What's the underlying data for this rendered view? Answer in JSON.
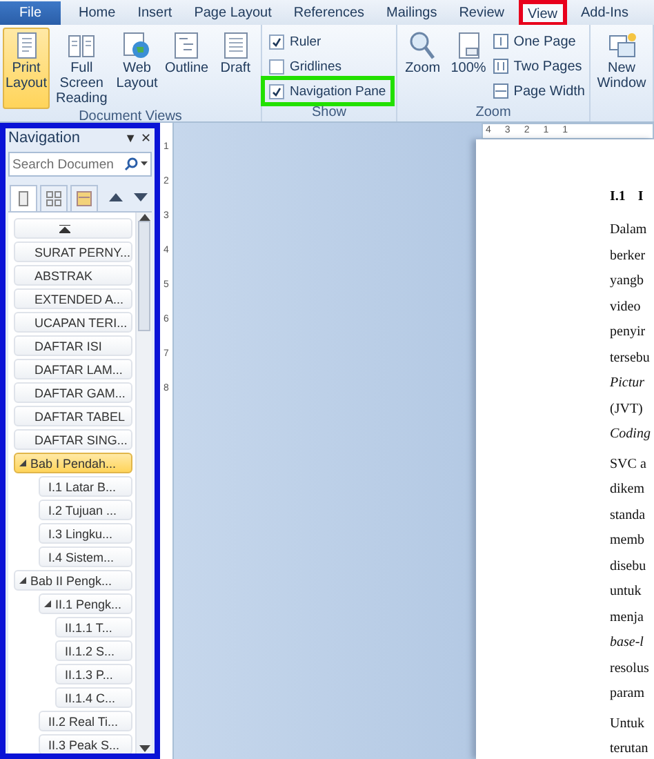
{
  "tabs": [
    {
      "label": "File",
      "kind": "file",
      "selected": false,
      "highlighted": false
    },
    {
      "label": "Home",
      "kind": "tab",
      "selected": false,
      "highlighted": false
    },
    {
      "label": "Insert",
      "kind": "tab",
      "selected": false,
      "highlighted": false
    },
    {
      "label": "Page Layout",
      "kind": "tab",
      "selected": false,
      "highlighted": false
    },
    {
      "label": "References",
      "kind": "tab",
      "selected": false,
      "highlighted": false
    },
    {
      "label": "Mailings",
      "kind": "tab",
      "selected": false,
      "highlighted": false
    },
    {
      "label": "Review",
      "kind": "tab",
      "selected": false,
      "highlighted": false
    },
    {
      "label": "View",
      "kind": "tab",
      "selected": true,
      "highlighted": true
    },
    {
      "label": "Add-Ins",
      "kind": "tab",
      "selected": false,
      "highlighted": false
    }
  ],
  "ribbon": {
    "document_views": {
      "label": "Document Views",
      "buttons": [
        {
          "label": "Print Layout",
          "selected": true
        },
        {
          "label": "Full Screen Reading",
          "selected": false
        },
        {
          "label": "Web Layout",
          "selected": false
        },
        {
          "label": "Outline",
          "selected": false
        },
        {
          "label": "Draft",
          "selected": false
        }
      ]
    },
    "show": {
      "label": "Show",
      "checkboxes": [
        {
          "label": "Ruler",
          "checked": true,
          "highlighted": false
        },
        {
          "label": "Gridlines",
          "checked": false,
          "highlighted": false
        },
        {
          "label": "Navigation Pane",
          "checked": true,
          "highlighted": true
        }
      ]
    },
    "zoom": {
      "label": "Zoom",
      "large_buttons": [
        "Zoom",
        "100%"
      ],
      "small_buttons": [
        "One Page",
        "Two Pages",
        "Page Width"
      ]
    },
    "window": {
      "buttons": [
        "New Window"
      ]
    }
  },
  "navigation": {
    "title": "Navigation",
    "menu_glyph": "▼",
    "close_glyph": "✕",
    "highlighted": true,
    "search": {
      "placeholder": "Search Documen"
    },
    "view_tabs": [
      {
        "selected": true
      },
      {
        "selected": false
      },
      {
        "selected": false
      }
    ],
    "headings": [
      {
        "label": "SURAT PERNY...",
        "selected": false
      },
      {
        "label": "ABSTRAK",
        "selected": false
      },
      {
        "label": "EXTENDED A...",
        "selected": false
      },
      {
        "label": "UCAPAN TERI...",
        "selected": false
      },
      {
        "label": "DAFTAR ISI",
        "selected": false
      },
      {
        "label": "DAFTAR LAM...",
        "selected": false
      },
      {
        "label": "DAFTAR GAM...",
        "selected": false
      },
      {
        "label": "DAFTAR TABEL",
        "selected": false
      },
      {
        "label": "DAFTAR SING...",
        "selected": false
      },
      {
        "label": "Bab I Pendah...",
        "selected": true,
        "expanded": true,
        "children": [
          {
            "label": "I.1 Latar B...",
            "selected": false
          },
          {
            "label": "I.2 Tujuan ...",
            "selected": false
          },
          {
            "label": "I.3 Lingku...",
            "selected": false
          },
          {
            "label": "I.4 Sistem...",
            "selected": false
          }
        ]
      },
      {
        "label": "Bab II Pengk...",
        "selected": false,
        "expanded": true,
        "children": [
          {
            "label": "II.1 Pengk...",
            "selected": false,
            "expanded": true,
            "children": [
              {
                "label": "II.1.1 T...",
                "selected": false
              },
              {
                "label": "II.1.2 S...",
                "selected": false
              },
              {
                "label": "II.1.3 P...",
                "selected": false
              },
              {
                "label": "II.1.4 C...",
                "selected": false
              }
            ]
          },
          {
            "label": "II.2 Real Ti...",
            "selected": false
          },
          {
            "label": "II.3 Peak S...",
            "selected": false
          }
        ]
      }
    ]
  },
  "horizontal_ruler": [
    "4",
    "3",
    "2",
    "1",
    "1"
  ],
  "vertical_ruler": [
    "1",
    "2",
    "3",
    "4",
    "5",
    "6",
    "7",
    "8"
  ],
  "document": {
    "heading": [
      "I.1",
      "I"
    ],
    "paragraphs": [
      [
        {
          "text": "Dalam",
          "italic": false
        },
        {
          "text": "berker",
          "italic": false
        },
        {
          "text": "yangb",
          "italic": false
        },
        {
          "text": "video",
          "italic": false
        },
        {
          "text": "penyir",
          "italic": false
        },
        {
          "text": "tersebu",
          "italic": false
        },
        {
          "text": "Pictur",
          "italic": true
        },
        {
          "text": "(JVT)",
          "italic": false
        },
        {
          "text": "Coding",
          "italic": true
        }
      ],
      [
        {
          "text": "SVC a",
          "italic": false
        },
        {
          "text": "dikem",
          "italic": false
        },
        {
          "text": "standa",
          "italic": false
        },
        {
          "text": "memb",
          "italic": false
        },
        {
          "text": "disebu",
          "italic": false
        },
        {
          "text": "untuk",
          "italic": false
        },
        {
          "text": "menja",
          "italic": false
        },
        {
          "text": "base-l",
          "italic": true
        },
        {
          "text": "resolus",
          "italic": false
        },
        {
          "text": "param",
          "italic": false
        }
      ],
      [
        {
          "text": "Untuk",
          "italic": false
        },
        {
          "text": "terutan",
          "italic": false
        }
      ]
    ]
  }
}
